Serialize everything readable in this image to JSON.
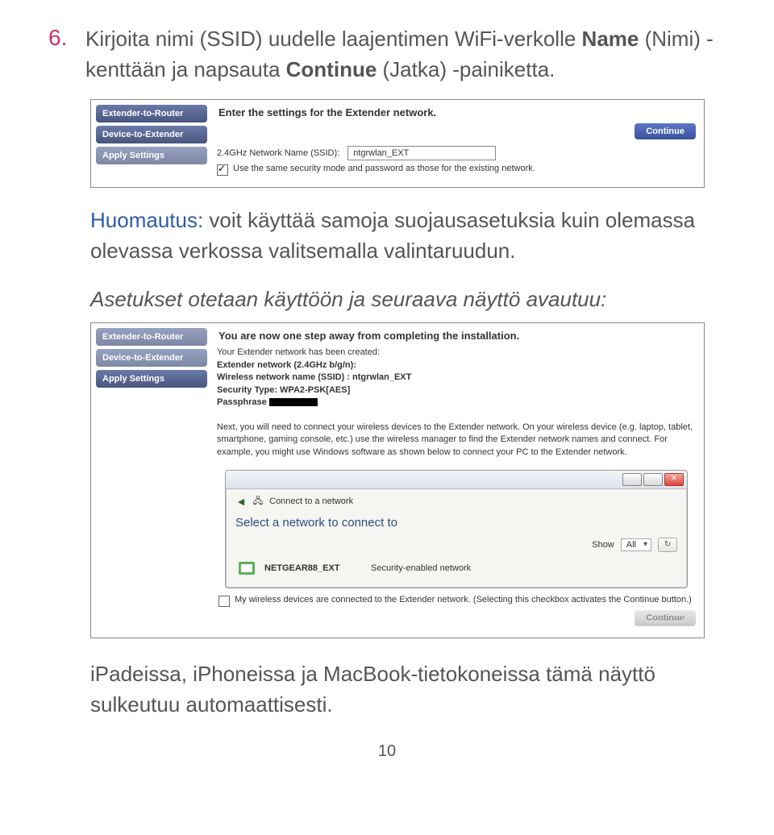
{
  "step": {
    "number": "6.",
    "text_before_name": "Kirjoita nimi (SSID) uudelle laajentimen WiFi-verkolle ",
    "name_bold": "Name",
    "text_mid": " (Nimi) -kenttään ja napsauta ",
    "continue_bold": "Continue",
    "text_after": " (Jatka) -painiketta."
  },
  "screenshot1": {
    "sidebar": {
      "items": [
        "Extender-to-Router",
        "Device-to-Extender",
        "Apply Settings"
      ]
    },
    "heading": "Enter the settings for the Extender network.",
    "continue_label": "Continue",
    "ssid_label": "2.4GHz Network Name (SSID):",
    "ssid_value": "ntgrwlan_EXT",
    "checkbox_label": "Use the same security mode and password as those for the existing network."
  },
  "note": {
    "label": "Huomautus:",
    "text": " voit käyttää samoja suojausasetuksia kuin olemassa olevassa verkossa valitsemalla valintaruudun.",
    "followup": "Asetukset otetaan käyttöön ja seuraava näyttö avautuu:"
  },
  "screenshot2": {
    "sidebar": {
      "items": [
        "Extender-to-Router",
        "Device-to-Extender",
        "Apply Settings"
      ]
    },
    "heading": "You are now one step away from completing the installation.",
    "info": {
      "created": "Your Extender network has been created:",
      "ext_net": "Extender network (2.4GHz b/g/n):",
      "ssid_line": "Wireless network name (SSID) : ntgrwlan_EXT",
      "sec_line": "Security Type: WPA2-PSK[AES]",
      "pass_label": "Passphrase"
    },
    "next_text": "Next, you will need to connect your wireless devices to the Extender network. On your wireless device (e.g. laptop, tablet, smartphone, gaming console, etc.) use the wireless manager to find the Extender network names and connect. For example, you might use Windows software as shown below to connect your PC to the Extender network.",
    "window": {
      "connect_label": "Connect to a network",
      "select_heading": "Select a network to connect to",
      "show_label": "Show",
      "show_value": "All",
      "network_name": "NETGEAR88_EXT",
      "network_security": "Security-enabled network"
    },
    "confirm_checkbox": "My wireless devices are connected to the Extender network. (Selecting this checkbox activates the Continue button.)",
    "continue_label": "Continue"
  },
  "footer_text": "iPadeissa, iPhoneissa ja MacBook-tietokoneissa tämä näyttö sulkeutuu automaattisesti.",
  "page_number": "10"
}
